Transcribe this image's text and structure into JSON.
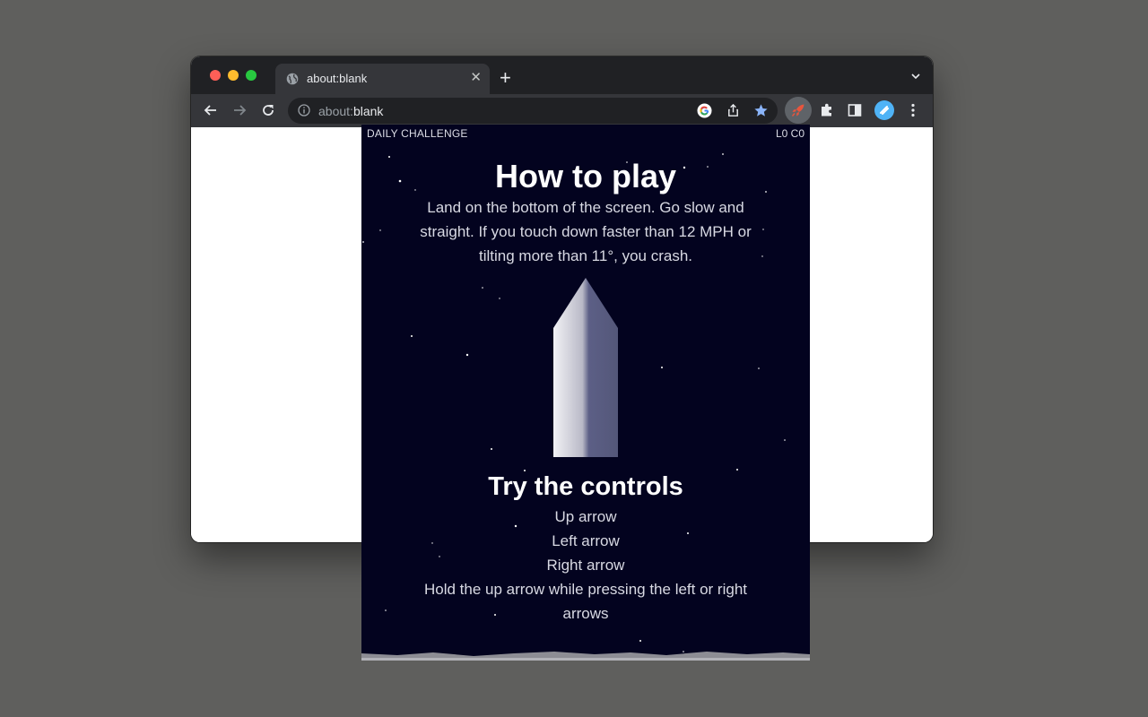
{
  "browser": {
    "tab_title": "about:blank",
    "new_tab": "+",
    "close": "✕",
    "url_prefix": "about:",
    "url_host": "blank"
  },
  "game": {
    "hud_left": "DAILY CHALLENGE",
    "hud_right": "L0 C0",
    "title": "How to play",
    "intro": "Land on the bottom of the screen. Go slow and straight. If you touch down faster than 12 MPH or tilting more than 11°, you crash.",
    "controls_title": "Try the controls",
    "controls": [
      "Up arrow",
      "Left arrow",
      "Right arrow",
      "Hold the up arrow while pressing the left or right arrows"
    ]
  },
  "colors": {
    "space": "#03031f",
    "accent_extension": "#e8553d"
  }
}
